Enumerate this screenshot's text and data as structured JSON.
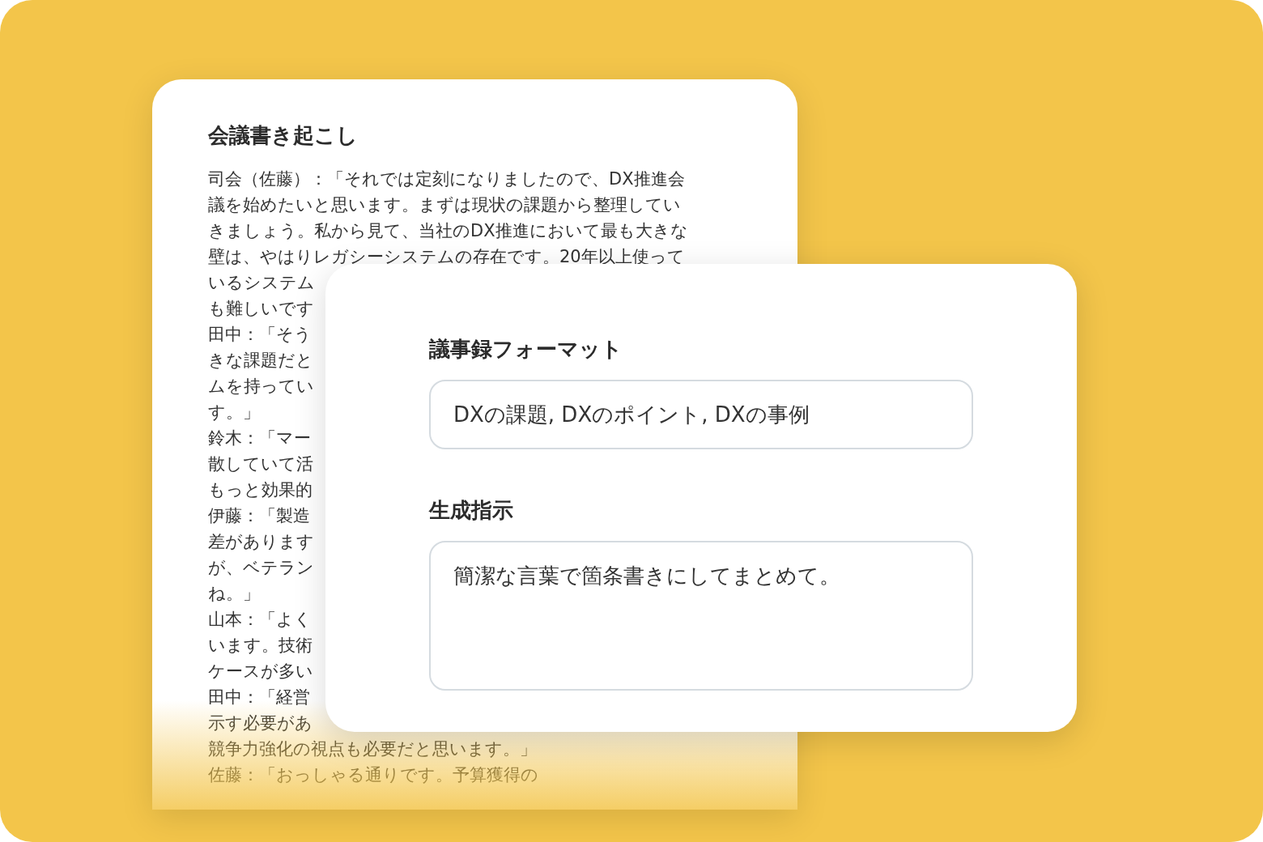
{
  "transcript": {
    "title": "会議書き起こし",
    "lines": [
      "司会（佐藤）：「それでは定刻になりましたので、DX推進会",
      "議を始めたいと思います。まずは現状の課題から整理してい",
      "きましょう。私から見て、当社のDX推進において最も大きな",
      "壁は、やはりレガシーシステムの存在です。20年以上使って",
      "いるシステム",
      "も難しいです",
      "田中：「そう",
      "きな課題だと",
      "ムを持ってい",
      "す。」",
      "鈴木：「マー",
      "散していて活",
      "もっと効果的",
      "伊藤：「製造",
      "差があります",
      "が、ベテラン",
      "ね。」",
      "山本：「よく",
      "います。技術",
      "ケースが多い",
      "田中：「経営",
      "示す必要があ",
      "競争力強化の視点も必要だと思います。」",
      "佐藤：「おっしゃる通りです。予算獲得の"
    ]
  },
  "format_panel": {
    "fields": [
      {
        "kind": "input",
        "label": "議事録フォーマット",
        "value": "DXの課題, DXのポイント, DXの事例"
      },
      {
        "kind": "textarea",
        "label": "生成指示",
        "value": "簡潔な言葉で箇条書きにしてまとめて。"
      }
    ]
  }
}
